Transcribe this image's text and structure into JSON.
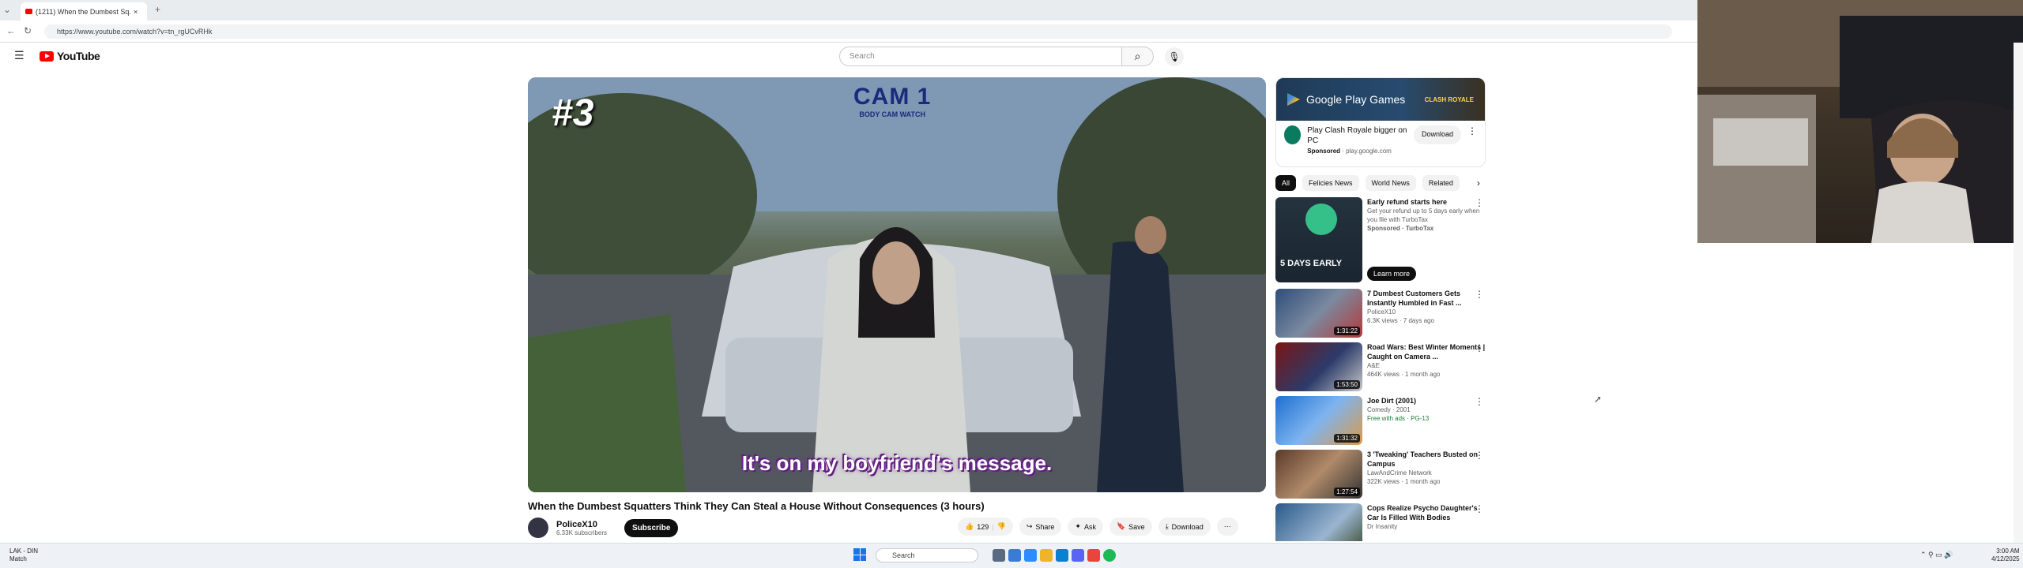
{
  "browser": {
    "tab_title": "(1211) When the Dumbest Sq...",
    "url": "https://www.youtube.com/watch?v=tn_rgUCvRHk"
  },
  "header": {
    "logo_text": "YouTube",
    "search_placeholder": "Search"
  },
  "video": {
    "rank_overlay": "#3",
    "cam_overlay": "CAM 1",
    "cam_sub": "BODY CAM WATCH",
    "caption": "It's on my boyfriend's message.",
    "title": "When the Dumbest Squatters Think They Can Steal a House Without Consequences (3 hours)",
    "channel": "PoliceX10",
    "subscribers": "6.33K subscribers",
    "subscribe_label": "Subscribe",
    "likes": "129",
    "share_label": "Share",
    "ask_label": "Ask",
    "save_label": "Save",
    "download_label": "Download"
  },
  "ad": {
    "banner_brand": "Google Play Games",
    "banner_game": "CLASH ROYALE",
    "title": "Play Clash Royale bigger on PC",
    "sponsored": "Sponsored",
    "domain": "play.google.com",
    "download_label": "Download"
  },
  "chips": [
    "All",
    "Felicies News",
    "World News",
    "Related"
  ],
  "recommendations": [
    {
      "title": "Early refund starts here",
      "meta1": "Get your refund up to 5 days early when you file with TurboTax",
      "meta2": "Sponsored · TurboTax",
      "duration": "",
      "thumb_text": "5 DAYS EARLY",
      "cta": "Learn more"
    },
    {
      "title": "7 Dumbest Customers Gets Instantly Humbled in Fast ...",
      "meta1": "PoliceX10",
      "meta2": "6.3K views · 7 days ago",
      "duration": "1:31:22"
    },
    {
      "title": "Road Wars: Best Winter Moments | Caught on Camera ...",
      "meta1": "A&E",
      "meta2": "464K views · 1 month ago",
      "duration": "1:53:50"
    },
    {
      "title": "Joe Dirt (2001)",
      "meta1": "Comedy · 2001",
      "meta2": "Free with ads · PG-13",
      "duration": "1:31:32"
    },
    {
      "title": "3 'Tweaking' Teachers Busted on Campus",
      "meta1": "LawAndCrime Network",
      "meta2": "322K views · 1 month ago",
      "duration": "1:27:54"
    },
    {
      "title": "Cops Realize Psycho Daughter's Car Is Filled With Bodies",
      "meta1": "Dr Insanity",
      "meta2": "",
      "duration": ""
    }
  ],
  "taskbar": {
    "weather_temp": "LAK - DIN",
    "weather_desc": "Match",
    "search_label": "Search",
    "time": "3:00 AM",
    "date": "4/12/2025"
  }
}
